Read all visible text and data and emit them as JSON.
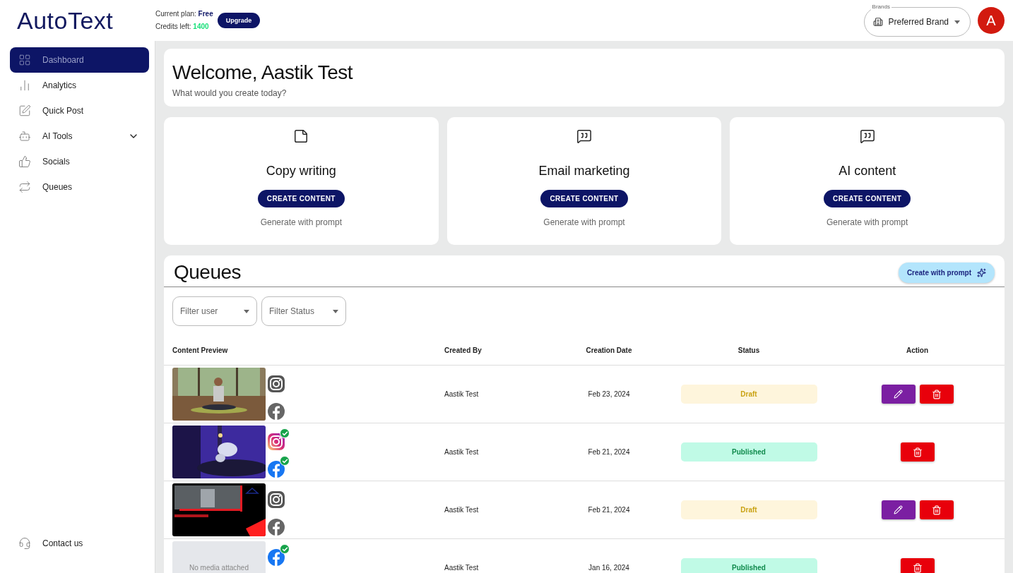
{
  "header": {
    "logo": "AutoText",
    "plan_label": "Current plan:",
    "plan": "Free",
    "credits_label": "Credits left:",
    "credits": "1400",
    "upgrade": "Upgrade",
    "brands_label": "Brands",
    "brand": "Preferred Brand",
    "avatar": "A"
  },
  "sidebar": {
    "items": [
      {
        "label": "Dashboard",
        "selected": true,
        "expandable": false
      },
      {
        "label": "Analytics",
        "selected": false,
        "expandable": false
      },
      {
        "label": "Quick Post",
        "selected": false,
        "expandable": false
      },
      {
        "label": "AI Tools",
        "selected": false,
        "expandable": true
      },
      {
        "label": "Socials",
        "selected": false,
        "expandable": false
      },
      {
        "label": "Queues",
        "selected": false,
        "expandable": false
      }
    ],
    "footer": {
      "label": "Contact us"
    }
  },
  "welcome": {
    "title": "Welcome, Aastik Test",
    "subtitle": "What would you create today?"
  },
  "cards": [
    {
      "title": "Copy writing",
      "button": "CREATE CONTENT",
      "hint": "Generate with prompt"
    },
    {
      "title": "Email marketing",
      "button": "CREATE CONTENT",
      "hint": "Generate with prompt"
    },
    {
      "title": "AI content",
      "button": "CREATE CONTENT",
      "hint": "Generate with prompt"
    }
  ],
  "queues": {
    "title": "Queues",
    "prompt_button": "Create with prompt",
    "filters": [
      {
        "placeholder": "Filter user"
      },
      {
        "placeholder": "Filter Status"
      }
    ],
    "columns": [
      "Content Preview",
      "Created By",
      "Creation Date",
      "Status",
      "Action"
    ],
    "rows": [
      {
        "preview": {
          "kind": "picture"
        },
        "socials": [
          {
            "kind": "instagram",
            "posted": false
          },
          {
            "kind": "facebook",
            "posted": false
          }
        ],
        "created_by": "Aastik Test",
        "date": "Feb 23, 2024",
        "status": {
          "label": "Draft",
          "kind": "draft"
        },
        "editable": true
      },
      {
        "preview": {
          "kind": "picture"
        },
        "socials": [
          {
            "kind": "instagram",
            "posted": true
          },
          {
            "kind": "facebook",
            "posted": true
          }
        ],
        "created_by": "Aastik Test",
        "date": "Feb 21, 2024",
        "status": {
          "label": "Published",
          "kind": "published"
        },
        "editable": false
      },
      {
        "preview": {
          "kind": "picture"
        },
        "socials": [
          {
            "kind": "instagram",
            "posted": false
          },
          {
            "kind": "facebook",
            "posted": false
          }
        ],
        "created_by": "Aastik Test",
        "date": "Feb 21, 2024",
        "status": {
          "label": "Draft",
          "kind": "draft"
        },
        "editable": true
      },
      {
        "preview": {
          "kind": "empty",
          "text": "No media attached"
        },
        "socials": [
          {
            "kind": "facebook",
            "posted": true
          }
        ],
        "created_by": "Aastik Test",
        "date": "Jan 16, 2024",
        "status": {
          "label": "Published",
          "kind": "published"
        },
        "editable": false
      }
    ]
  }
}
